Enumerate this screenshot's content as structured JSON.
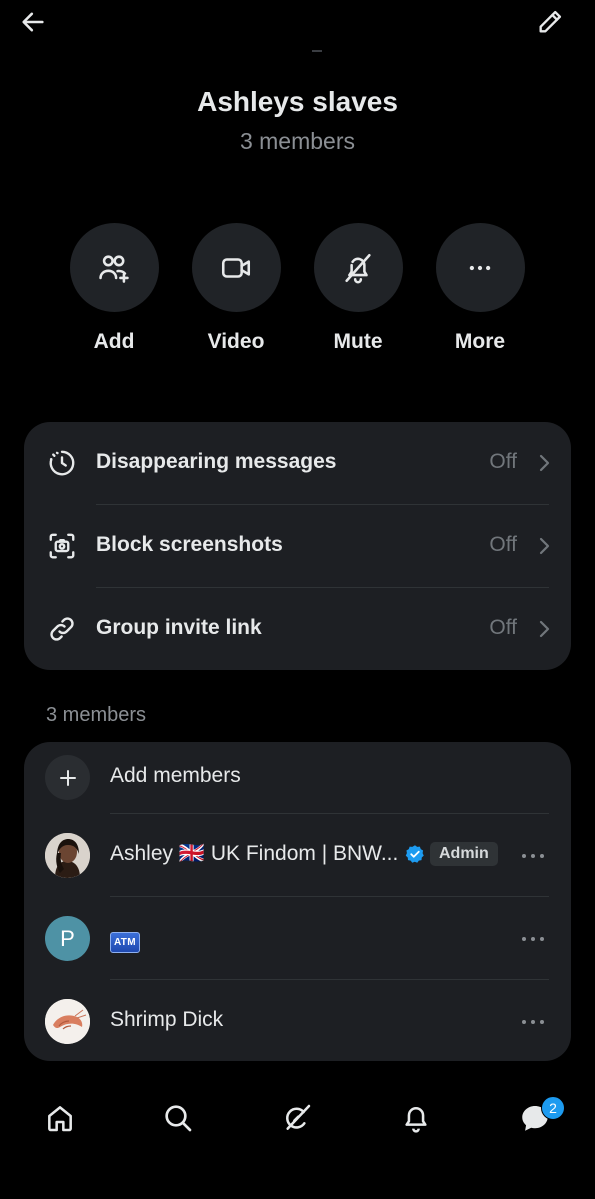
{
  "header": {
    "back_icon": "arrow-left-icon",
    "edit_icon": "pencil-icon"
  },
  "group": {
    "name": "Ashleys slaves",
    "member_count_text": "3 members"
  },
  "actions": [
    {
      "label": "Add",
      "icon": "add-people-icon"
    },
    {
      "label": "Video",
      "icon": "video-camera-icon"
    },
    {
      "label": "Mute",
      "icon": "bell-slash-icon"
    },
    {
      "label": "More",
      "icon": "more-horizontal-icon"
    }
  ],
  "settings": [
    {
      "label": "Disappearing messages",
      "value": "Off",
      "icon": "timer-icon"
    },
    {
      "label": "Block screenshots",
      "value": "Off",
      "icon": "screenshot-camera-icon"
    },
    {
      "label": "Group invite link",
      "value": "Off",
      "icon": "link-icon"
    }
  ],
  "members_section": {
    "heading": "3 members",
    "add_members_label": "Add members",
    "members": [
      {
        "name": "Ashley 🇬🇧 UK Findom | BNW...",
        "verified": true,
        "badge": "Admin",
        "avatar": "photo"
      },
      {
        "name": "ATM",
        "avatar_letter": "P",
        "avatar_color": "#4e92a5"
      },
      {
        "name": "Shrimp Dick",
        "avatar": "photo"
      }
    ]
  },
  "bottom_nav": {
    "items": [
      "home-icon",
      "search-icon",
      "grok-icon",
      "bell-icon",
      "messages-icon"
    ],
    "messages_badge": "2"
  },
  "colors": {
    "background": "#000000",
    "card": "#1d1f23",
    "action_circle": "#202327",
    "accent": "#1d9bf0"
  }
}
